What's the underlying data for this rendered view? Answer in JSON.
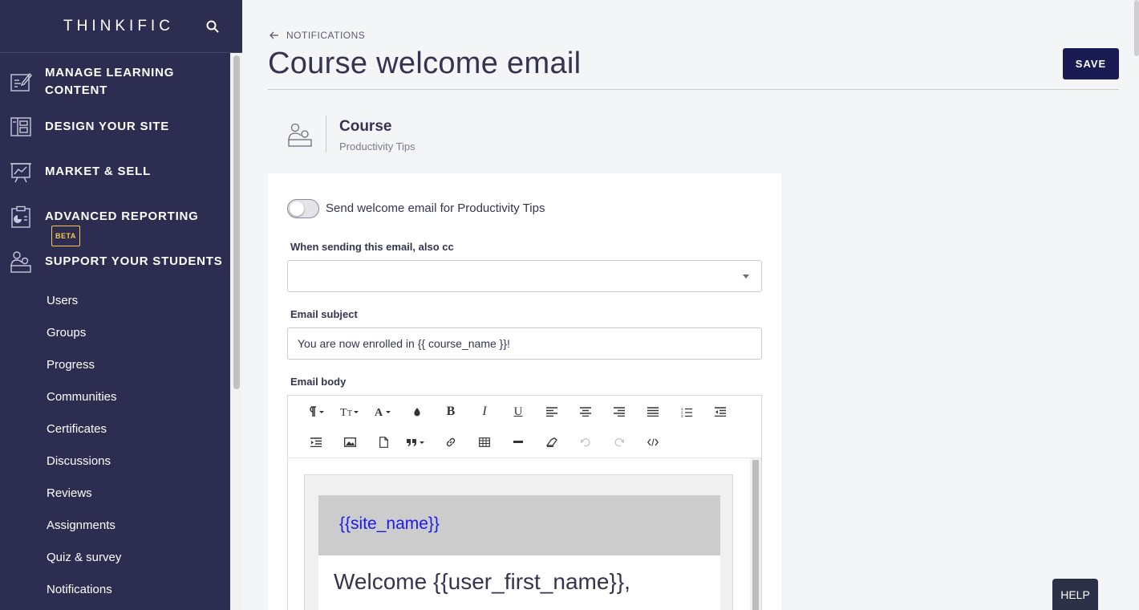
{
  "brand": {
    "name": "THINKIFIC",
    "search_icon": "search-icon"
  },
  "sidebar": {
    "main_items": [
      {
        "label": "MANAGE LEARNING",
        "label2": "CONTENT",
        "icon": "edit-document-icon"
      },
      {
        "label": "DESIGN YOUR SITE",
        "icon": "layout-icon"
      },
      {
        "label": "MARKET & SELL",
        "icon": "chart-board-icon"
      },
      {
        "label": "ADVANCED REPORTING",
        "badge": "BETA",
        "icon": "report-clipboard-icon"
      },
      {
        "label": "SUPPORT YOUR STUDENTS",
        "icon": "students-icon"
      }
    ],
    "sub_items": [
      "Users",
      "Groups",
      "Progress",
      "Communities",
      "Certificates",
      "Discussions",
      "Reviews",
      "Assignments",
      "Quiz & survey",
      "Notifications"
    ]
  },
  "header": {
    "back_label": "NOTIFICATIONS",
    "title": "Course welcome email",
    "save_label": "SAVE"
  },
  "course": {
    "kind": "Course",
    "name": "Productivity Tips"
  },
  "form": {
    "toggle_label": "Send welcome email for Productivity Tips",
    "toggle_on": false,
    "cc_label": "When sending this email, also cc",
    "cc_value": "",
    "subject_label": "Email subject",
    "subject_value": "You are now enrolled in {{ course_name }}!",
    "body_label": "Email body"
  },
  "editor": {
    "site_name": "{{site_name}}",
    "welcome": "Welcome {{user_first_name}},"
  },
  "help_label": "HELP",
  "colors": {
    "sidebar": "#2d2d51",
    "save": "#1b1b54",
    "beta": "#f5c84c",
    "link": "#1a1aee"
  }
}
